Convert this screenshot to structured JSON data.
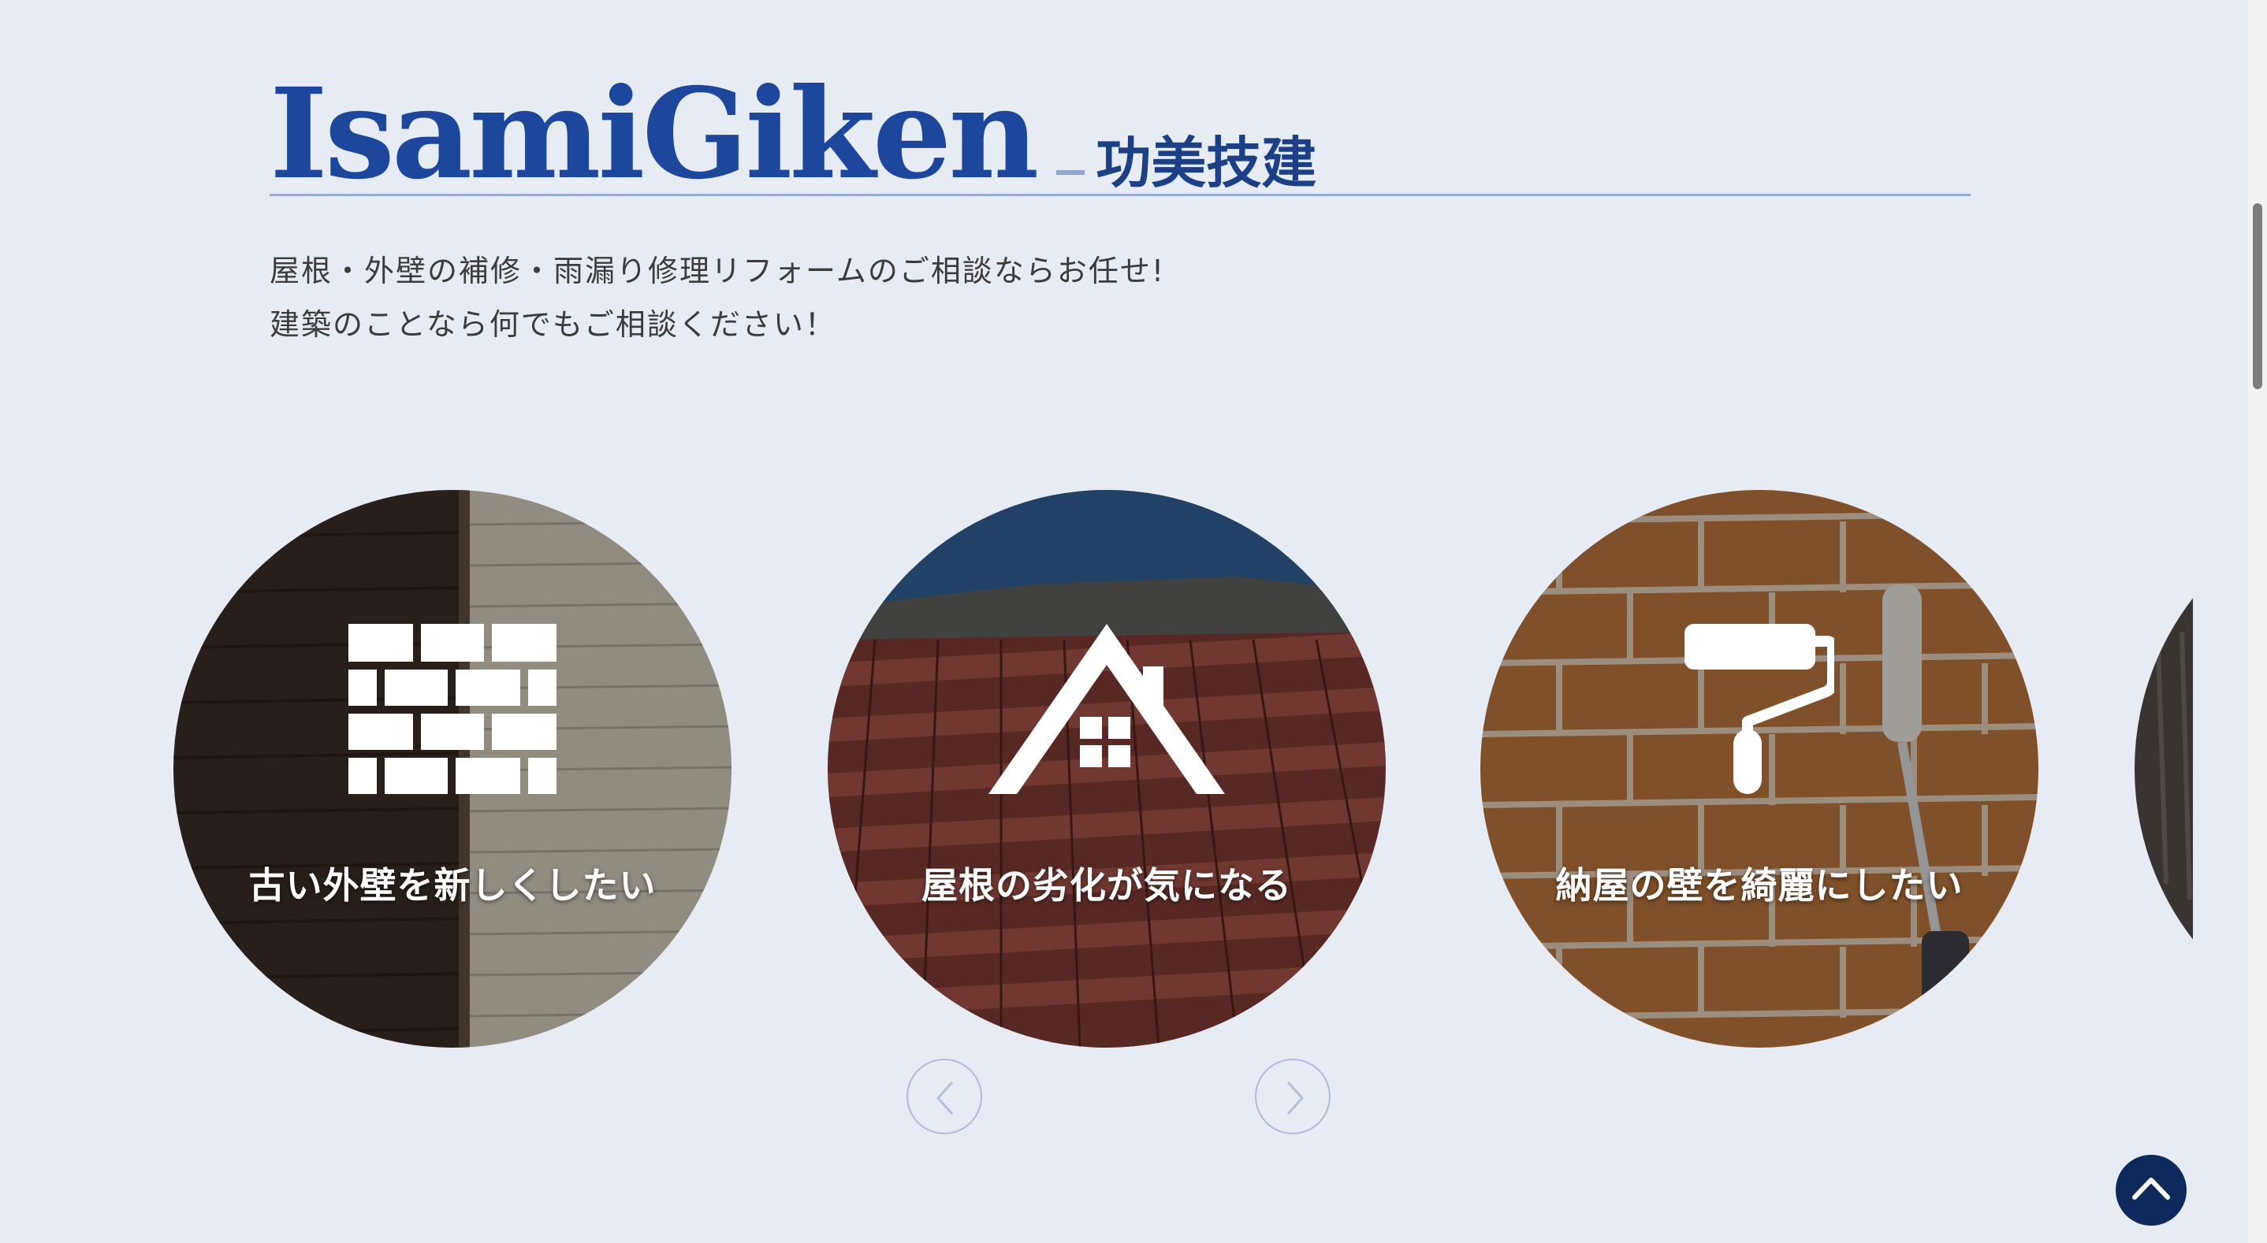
{
  "brand": {
    "name_en": "IsamiGiken",
    "name_jp": "功美技建"
  },
  "tagline": {
    "line1": "屋根・外壁の補修・雨漏り修理リフォームのご相談ならお任せ!",
    "line2": "建築のことなら何でもご相談ください！"
  },
  "carousel": {
    "items": [
      {
        "label": "古い外壁を新しくしたい",
        "icon": "brick-wall-icon"
      },
      {
        "label": "屋根の劣化が気になる",
        "icon": "house-roof-icon"
      },
      {
        "label": "納屋の壁を綺麗にしたい",
        "icon": "paint-roller-icon"
      }
    ],
    "prev_icon": "chevron-left-icon",
    "next_icon": "chevron-right-icon"
  },
  "back_to_top": {
    "icon": "chevron-up-icon"
  },
  "colors": {
    "background": "#e6ebf4",
    "brand": "#1c479c",
    "accent_dark": "#0e2a5c"
  }
}
